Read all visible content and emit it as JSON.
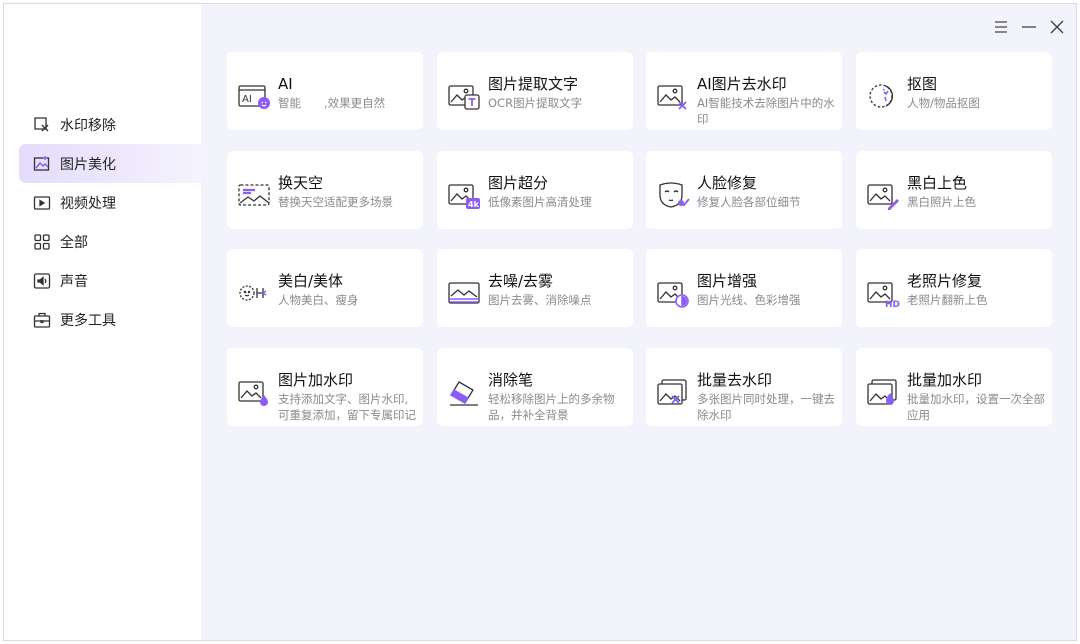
{
  "colors": {
    "accent": "#8b5cf6",
    "sidebar_active": "#ebe5fc",
    "main_bg": "#f3f4fb",
    "icon_stroke": "#333333"
  },
  "window_controls": [
    {
      "name": "menu-icon"
    },
    {
      "name": "minimize-icon"
    },
    {
      "name": "close-icon"
    }
  ],
  "sidebar": {
    "items": [
      {
        "label": "水印移除",
        "icon": "watermark-remove-icon",
        "active": false
      },
      {
        "label": "图片美化",
        "icon": "image-beautify-icon",
        "active": true
      },
      {
        "label": "视频处理",
        "icon": "video-icon",
        "active": false
      },
      {
        "label": "全部",
        "icon": "grid-icon",
        "active": false
      },
      {
        "label": "声音",
        "icon": "audio-icon",
        "active": false
      },
      {
        "label": "更多工具",
        "icon": "toolbox-icon",
        "active": false
      }
    ]
  },
  "tools": [
    {
      "title": "AI",
      "desc": "智能　　,效果更自然",
      "icon": "ai-icon"
    },
    {
      "title": "图片提取文字",
      "desc": "OCR图片提取文字",
      "icon": "ocr-icon"
    },
    {
      "title": "AI图片去水印",
      "desc": "AI智能技术去除图片中的水印",
      "icon": "ai-watermark-remove-icon"
    },
    {
      "title": "抠图",
      "desc": "人物/物品抠图",
      "icon": "cutout-icon"
    },
    {
      "title": "换天空",
      "desc": "替换天空适配更多场景",
      "icon": "sky-replace-icon"
    },
    {
      "title": "图片超分",
      "desc": "低像素图片高清处理",
      "icon": "super-resolution-icon"
    },
    {
      "title": "人脸修复",
      "desc": "修复人脸各部位细节",
      "icon": "face-repair-icon"
    },
    {
      "title": "黑白上色",
      "desc": "黑白照片上色",
      "icon": "colorize-icon"
    },
    {
      "title": "美白/美体",
      "desc": "人物美白、瘦身",
      "icon": "beauty-icon"
    },
    {
      "title": "去噪/去雾",
      "desc": "图片去雾、消除噪点",
      "icon": "denoise-icon"
    },
    {
      "title": "图片增强",
      "desc": "图片光线、色彩增强",
      "icon": "enhance-icon"
    },
    {
      "title": "老照片修复",
      "desc": "老照片翻新上色",
      "icon": "old-photo-repair-icon"
    },
    {
      "title": "图片加水印",
      "desc": "支持添加文字、图片水印,可重复添加，留下专属印记",
      "icon": "add-watermark-icon"
    },
    {
      "title": "消除笔",
      "desc": "轻松移除图片上的多余物品，并补全背景",
      "icon": "eraser-icon"
    },
    {
      "title": "批量去水印",
      "desc": "多张图片同时处理，一键去除水印",
      "icon": "batch-remove-watermark-icon"
    },
    {
      "title": "批量加水印",
      "desc": "批量加水印，设置一次全部应用",
      "icon": "batch-add-watermark-icon"
    }
  ]
}
